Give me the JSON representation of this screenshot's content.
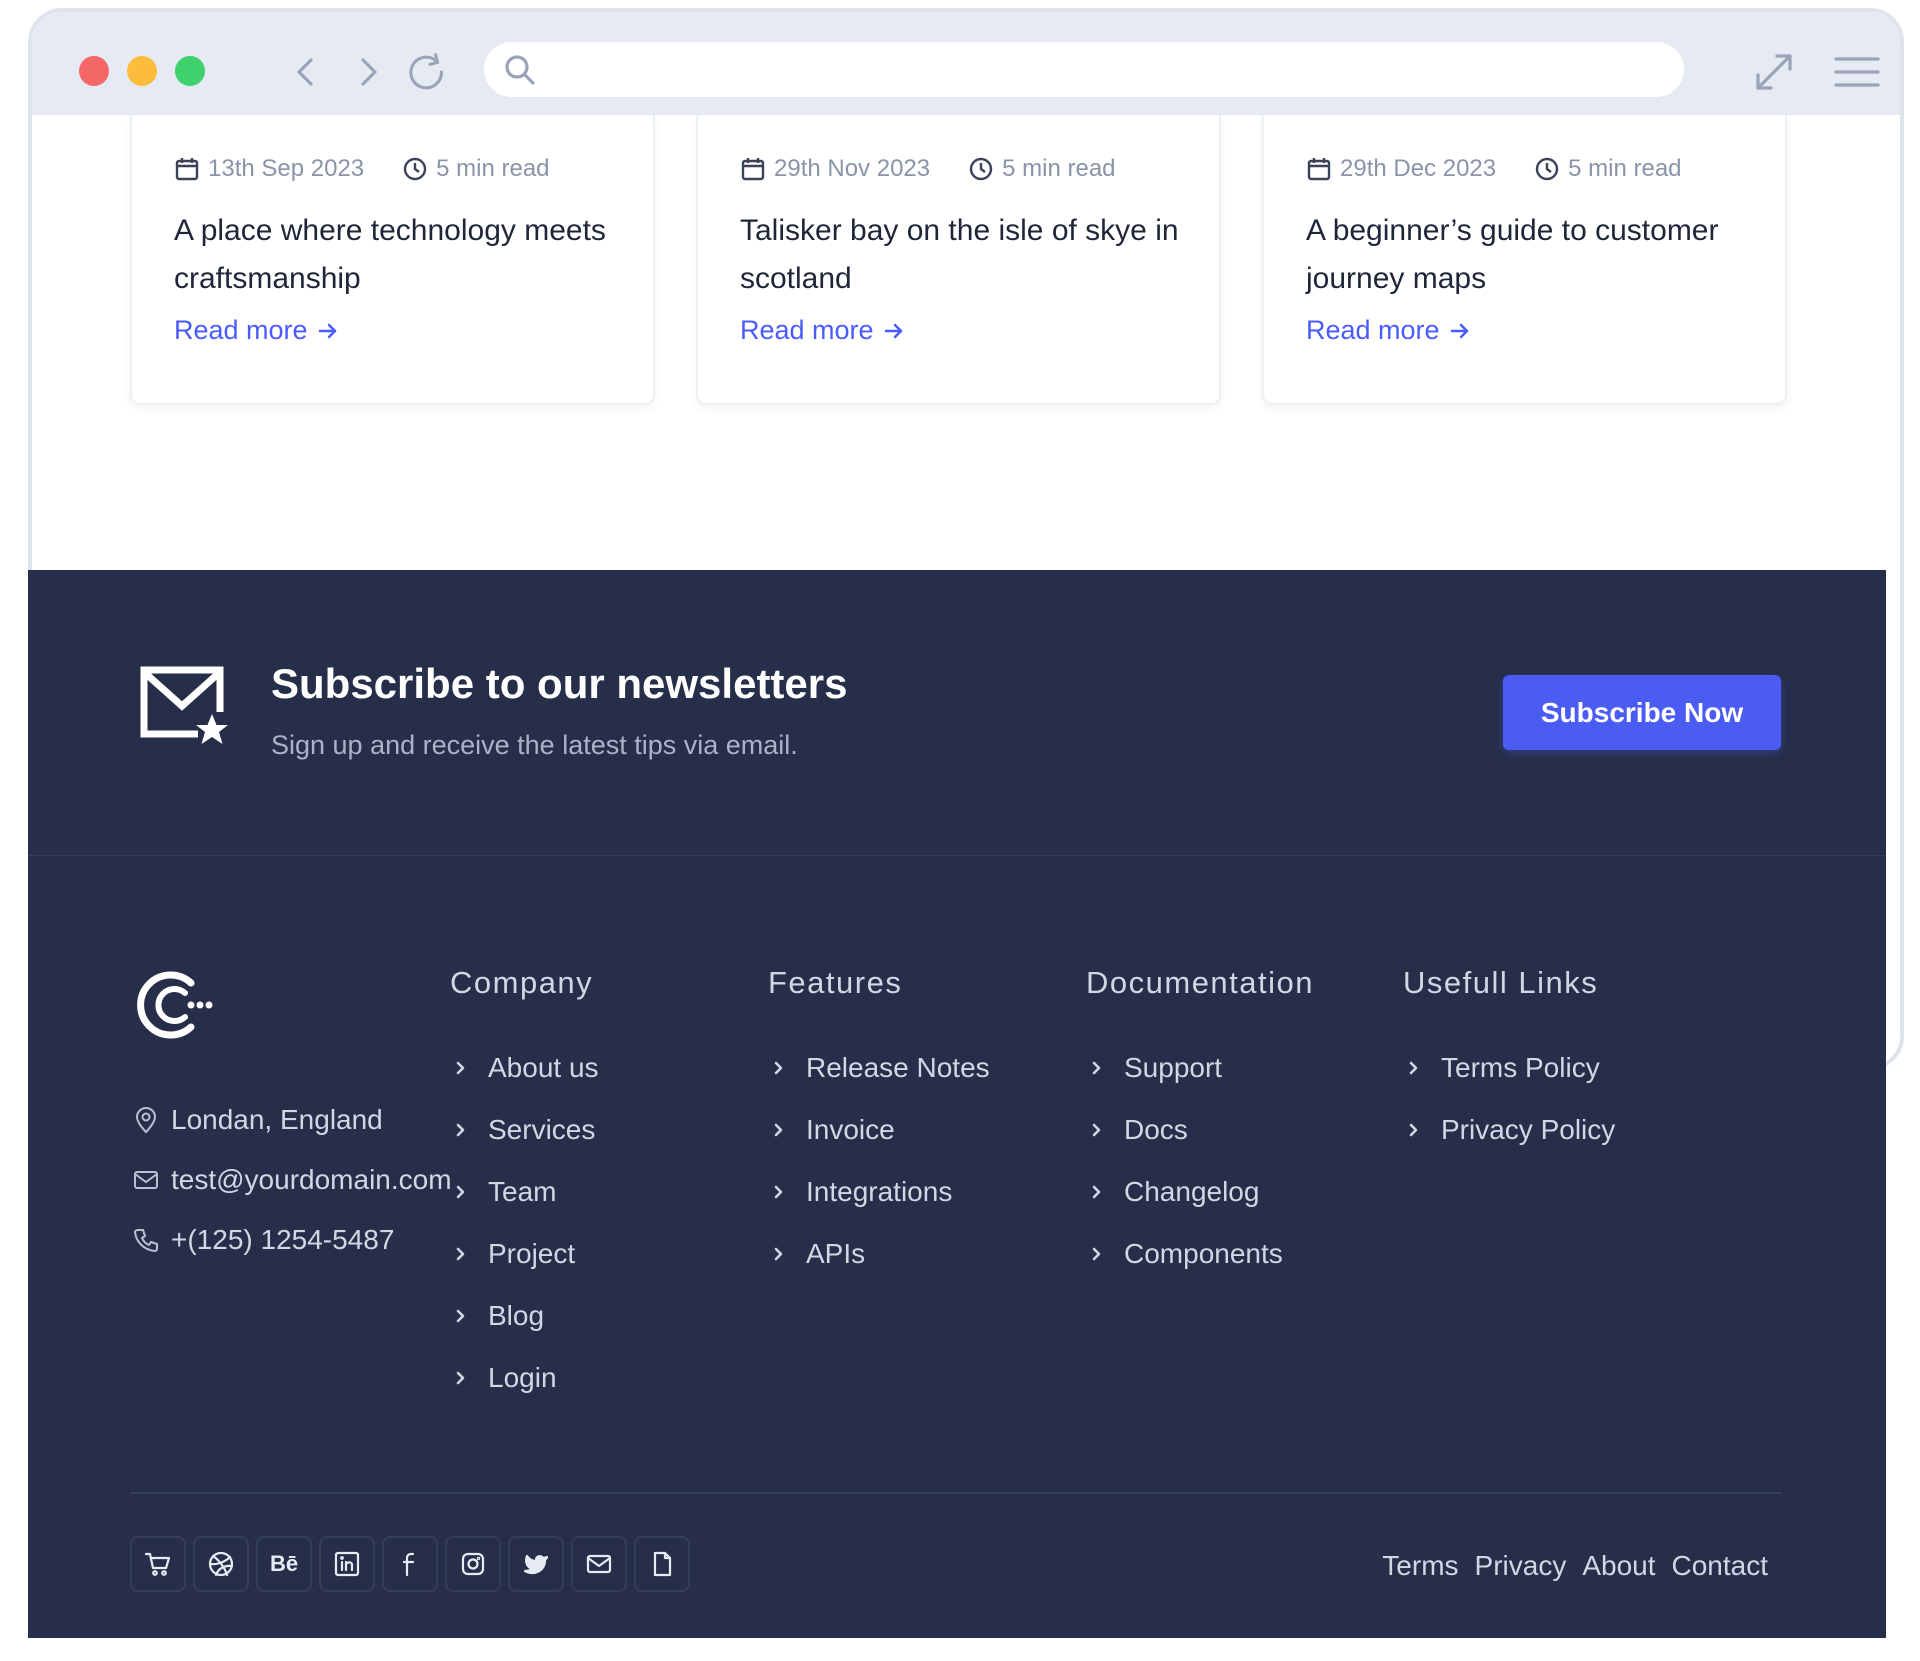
{
  "browser": {
    "url_placeholder": ""
  },
  "cards": [
    {
      "date": "13th Sep 2023",
      "read_time": "5 min read",
      "title": "A place where technology meets craftsmanship",
      "link": "Read more"
    },
    {
      "date": "29th Nov 2023",
      "read_time": "5 min read",
      "title": "Talisker bay on the isle of skye in scotland",
      "link": "Read more"
    },
    {
      "date": "29th Dec 2023",
      "read_time": "5 min read",
      "title": "A beginner’s guide to customer journey maps",
      "link": "Read more"
    }
  ],
  "newsletter": {
    "title": "Subscribe to our newsletters",
    "subtitle": "Sign up and receive the latest tips via email.",
    "button": "Subscribe Now"
  },
  "contact": {
    "location": "Londan, England",
    "email": "test@yourdomain.com",
    "phone": "+(125) 1254-5487"
  },
  "columns": [
    {
      "heading": "Company",
      "items": [
        "About us",
        "Services",
        "Team",
        "Project",
        "Blog",
        "Login"
      ]
    },
    {
      "heading": "Features",
      "items": [
        "Release Notes",
        "Invoice",
        "Integrations",
        "APIs"
      ]
    },
    {
      "heading": "Documentation",
      "items": [
        "Support",
        "Docs",
        "Changelog",
        "Components"
      ]
    },
    {
      "heading": "Usefull Links",
      "items": [
        "Terms Policy",
        "Privacy Policy"
      ]
    }
  ],
  "socials": [
    "cart-icon",
    "dribbble-icon",
    "behance-icon",
    "linkedin-icon",
    "facebook-icon",
    "instagram-icon",
    "twitter-icon",
    "mail-icon",
    "file-icon"
  ],
  "behance_label": "Bē",
  "bottom_links": [
    "Terms",
    "Privacy",
    "About",
    "Contact"
  ],
  "colors": {
    "footer_bg": "#262e4a",
    "accent": "#4a5cf2",
    "link": "#4a5cff"
  }
}
